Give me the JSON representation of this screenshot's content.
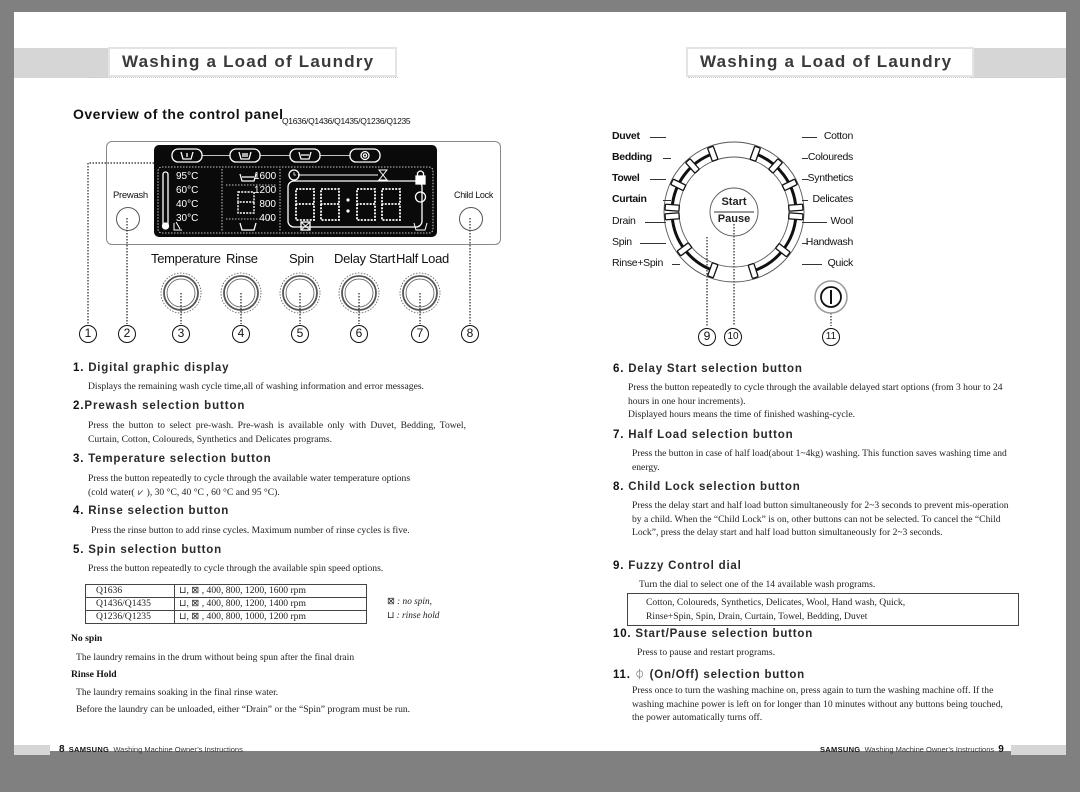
{
  "header": {
    "left_title": "Washing a Load of Laundry",
    "right_title": "Washing a Load of Laundry"
  },
  "overview": {
    "title": "Overview of the control panel",
    "models": "Q1636/Q1436/Q1435/Q1236/Q1235"
  },
  "control_panel": {
    "prewash_label": "Prewash",
    "child_lock_label": "Child Lock",
    "lcd": {
      "temperatures": [
        "95°C",
        "60°C",
        "40°C",
        "30°C"
      ],
      "spins": [
        "1600",
        "1200",
        "800",
        "400"
      ],
      "rinse_digit": "8",
      "time_digits": "88:88",
      "cycle_icons": [
        "prewash-icon",
        "wash-icon",
        "rinse-icon",
        "spin-icon"
      ],
      "half_load": "1/2"
    },
    "buttons": [
      {
        "label": "Temperature",
        "callout": "3"
      },
      {
        "label": "Rinse",
        "callout": "4"
      },
      {
        "label": "Spin",
        "callout": "5"
      },
      {
        "label": "Delay Start",
        "callout": "6"
      },
      {
        "label": "Half Load",
        "callout": "7"
      }
    ],
    "callouts_left": [
      "1",
      "2",
      "8"
    ]
  },
  "dial": {
    "left_programs": [
      {
        "label": "Duvet",
        "bold": true
      },
      {
        "label": "Bedding",
        "bold": true
      },
      {
        "label": "Towel",
        "bold": true
      },
      {
        "label": "Curtain",
        "bold": true
      },
      {
        "label": "Drain",
        "bold": false
      },
      {
        "label": "Spin",
        "bold": false
      },
      {
        "label": "Rinse+Spin",
        "bold": false
      }
    ],
    "right_programs": [
      "Cotton",
      "Coloureds",
      "Synthetics",
      "Delicates",
      "Wool",
      "Handwash",
      "Quick"
    ],
    "start_label": "Start",
    "pause_label": "Pause",
    "callouts": [
      "9",
      "10",
      "11"
    ]
  },
  "sections_left": [
    {
      "num": "1.",
      "title": "Digital graphic display",
      "body": "Displays the remaining wash cycle time,all of washing information and error messages."
    },
    {
      "num": "2.",
      "title": "Prewash selection button",
      "body": "Press the button to select pre-wash. Pre-wash is available only with Duvet, Bedding, Towel, Curtain, Cotton, Coloureds, Synthetics and Delicates programs."
    },
    {
      "num": "3.",
      "title": "Temperature selection button",
      "body_a": "Press the button  repeatedly to cycle through the available water temperature options",
      "body_b": "(cold water(",
      "body_c": "), 30 °C, 40 °C , 60 °C and 95 °C)."
    },
    {
      "num": "4.",
      "title": "Rinse selection button",
      "body": "Press the rinse button to add rinse cycles. Maximum number of rinse cycles is five."
    },
    {
      "num": "5.",
      "title": "Spin selection button",
      "body": "Press the button repeatedly to cycle through the available spin speed options."
    }
  ],
  "spin_table": {
    "rows": [
      {
        "model": "Q1636",
        "speeds": ", 400,  800,  1200,  1600 rpm"
      },
      {
        "model": "Q1436/Q1435",
        "speeds": ", 400,  800,  1200,  1400 rpm"
      },
      {
        "model": "Q1236/Q1235",
        "speeds": ", 400,  800,  1000,  1200 rpm"
      }
    ],
    "legend_no_spin": ": no spin,",
    "legend_rinse_hold": ": rinse hold"
  },
  "notes": {
    "no_spin_title": "No spin",
    "no_spin_body": "The laundry remains in the drum without being spun after the final drain",
    "rinse_hold_title": "Rinse Hold",
    "rinse_hold_body1": "The laundry remains soaking in the final rinse water.",
    "rinse_hold_body2": "Before the laundry can be unloaded, either “Drain” or the “Spin” program must be run."
  },
  "sections_right": [
    {
      "num": "6.",
      "title": "Delay Start selection button",
      "body1": "Press the button repeatedly to cycle through the available delayed start options (from 3 hour to 24 hours in one hour increments).",
      "body2": "Displayed hours means the time of finished washing-cycle."
    },
    {
      "num": "7.",
      "title": "Half Load selection button",
      "body": "Press the button in case of half load(about 1~4kg) washing. This function saves washing time and energy."
    },
    {
      "num": "8.",
      "title": "Child Lock selection button",
      "body": "Press the delay start and half load button simultaneously for 2~3 seconds to prevent mis-operation by a child. When the “Child Lock” is on, other buttons can not be selected. To cancel the “Child Lock”, press the delay start and half load button simultaneously for 2~3 seconds."
    },
    {
      "num": "9.",
      "title": "Fuzzy Control dial",
      "body": "Turn the dial to select one of the 14 available wash programs.",
      "programs_line1": "Cotton, Coloureds, Synthetics, Delicates, Wool, Hand wash, Quick,",
      "programs_line2": "Rinse+Spin, Spin, Drain, Curtain, Towel, Bedding, Duvet"
    },
    {
      "num": "10.",
      "title": "Start/Pause selection button",
      "body": "Press to pause and restart programs."
    },
    {
      "num": "11.",
      "title": "(On/Off) selection button",
      "icon": "power-icon",
      "body": "Press once to turn the washing machine on, press again to turn the washing machine off. If the washing machine power is left on for longer than 10 minutes without any buttons being touched, the power automatically turns off."
    }
  ],
  "footer": {
    "left_page": "8",
    "right_page": "9",
    "brand": "SAMSUNG",
    "text": "Washing Machine Owner’s Instructions"
  }
}
